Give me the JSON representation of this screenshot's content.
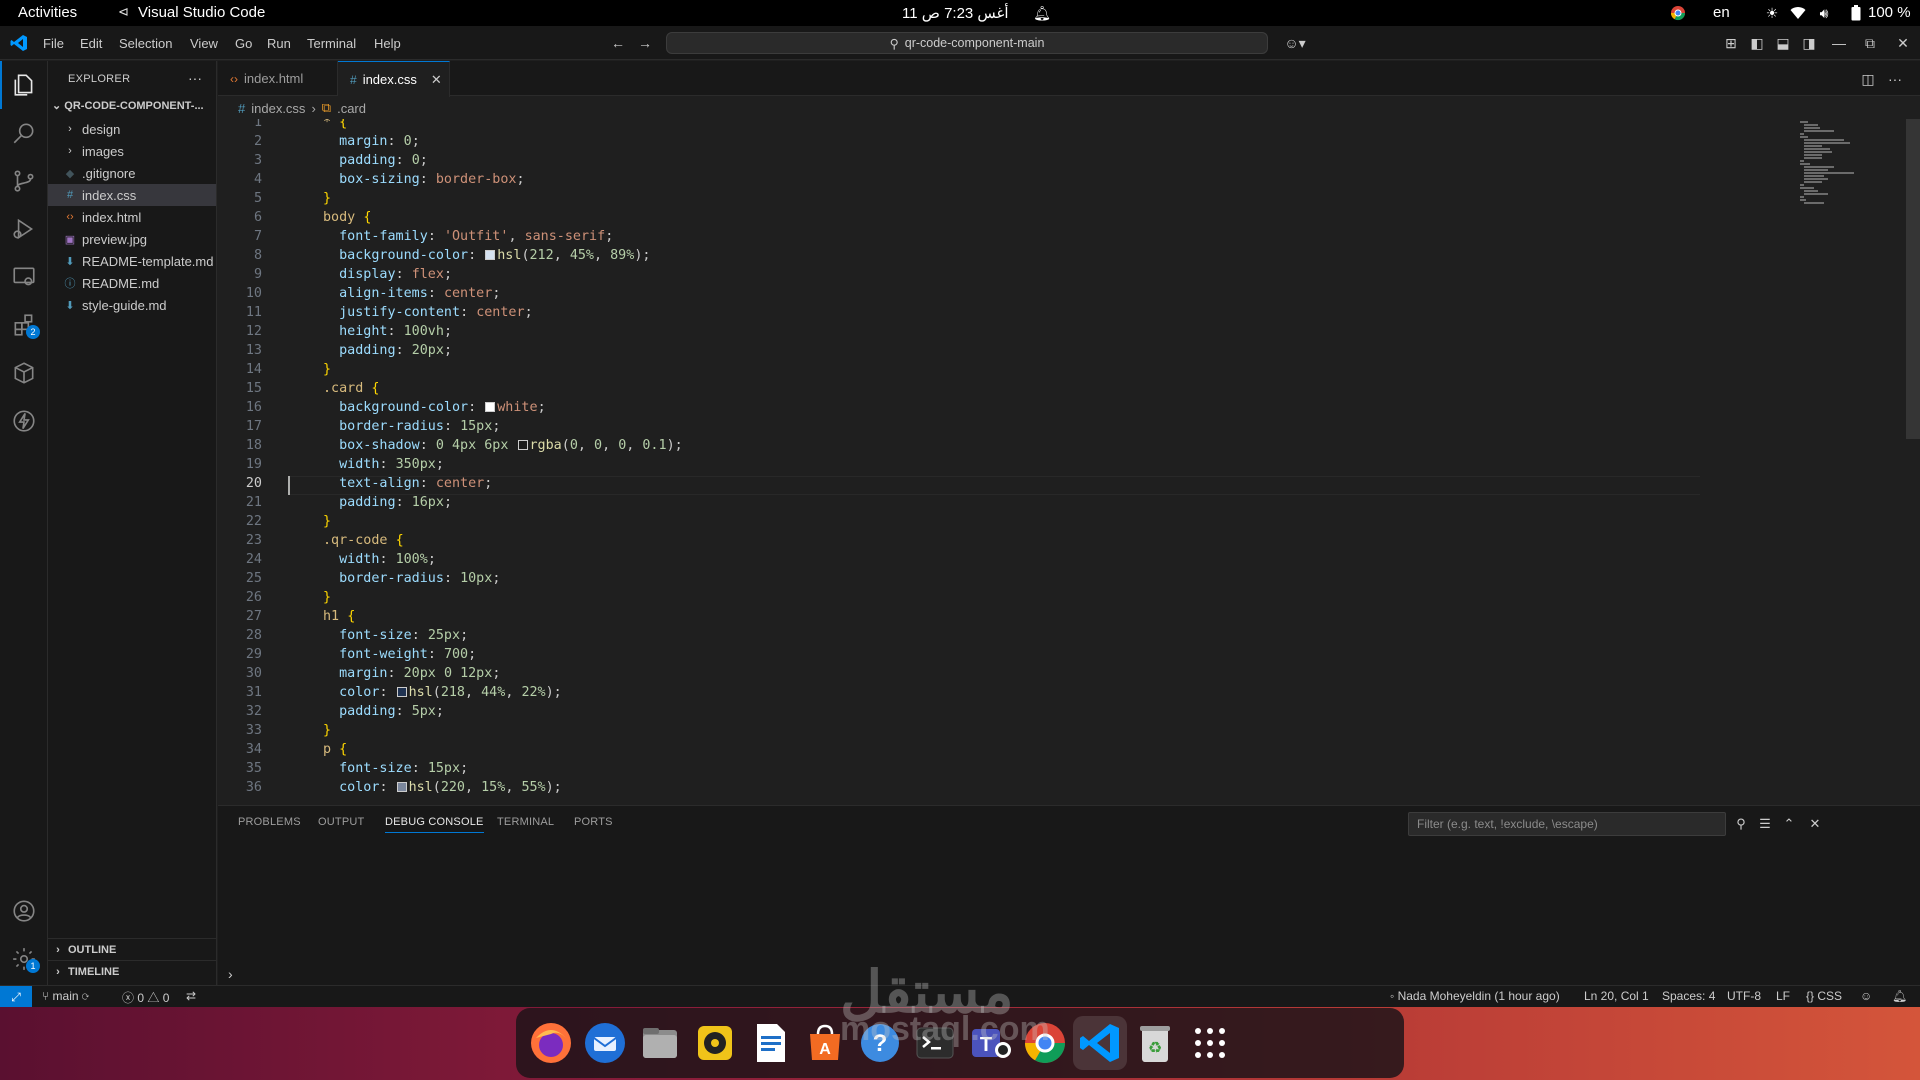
{
  "topbar": {
    "activities": "Activities",
    "app_name": "Visual Studio Code",
    "clock": "11 أغس  7:23 ص",
    "lang": "en",
    "battery": "100 %"
  },
  "menubar": {
    "items": [
      "File",
      "Edit",
      "Selection",
      "View",
      "Go",
      "Run",
      "Terminal",
      "Help"
    ],
    "command_center": "qr-code-component-main"
  },
  "sidebar": {
    "title": "EXPLORER",
    "root": "QR-CODE-COMPONENT-...",
    "items": [
      {
        "label": "design",
        "icon": "chevron-right-icon"
      },
      {
        "label": "images",
        "icon": "chevron-right-icon"
      },
      {
        "label": ".gitignore",
        "icon": "git-icon"
      },
      {
        "label": "index.css",
        "icon": "css-icon"
      },
      {
        "label": "index.html",
        "icon": "html-icon"
      },
      {
        "label": "preview.jpg",
        "icon": "image-icon"
      },
      {
        "label": "README-template.md",
        "icon": "markdown-icon"
      },
      {
        "label": "README.md",
        "icon": "info-icon"
      },
      {
        "label": "style-guide.md",
        "icon": "markdown-icon"
      }
    ],
    "outline": "OUTLINE",
    "timeline": "TIMELINE"
  },
  "tabs": [
    {
      "label": "index.html",
      "active": false
    },
    {
      "label": "index.css",
      "active": true
    }
  ],
  "breadcrumb": {
    "file": "index.css",
    "symbol": ".card"
  },
  "editor": {
    "current_line": 20,
    "lines": [
      "* {",
      "  margin: 0;",
      "  padding: 0;",
      "  box-sizing: border-box;",
      "}",
      "body {",
      "  font-family: 'Outfit', sans-serif;",
      "  background-color: hsl(212, 45%, 89%);",
      "  display: flex;",
      "  align-items: center;",
      "  justify-content: center;",
      "  height: 100vh;",
      "  padding: 20px;",
      "}",
      ".card {",
      "  background-color: white;",
      "  border-radius: 15px;",
      "  box-shadow: 0 4px 6px rgba(0, 0, 0, 0.1);",
      "  width: 350px;",
      "  text-align: center;",
      "  padding: 16px;",
      "}",
      ".qr-code {",
      "  width: 100%;",
      "  border-radius: 10px;",
      "}",
      "h1 {",
      "  font-size: 25px;",
      "  font-weight: 700;",
      "  margin: 20px 0 12px;",
      "  color: hsl(218, 44%, 22%);",
      "  padding: 5px;",
      "}",
      "p {",
      "  font-size: 15px;",
      "  color: hsl(220, 15%, 55%);"
    ]
  },
  "panel": {
    "tabs": [
      "PROBLEMS",
      "OUTPUT",
      "DEBUG CONSOLE",
      "TERMINAL",
      "PORTS"
    ],
    "active_tab": "DEBUG CONSOLE",
    "filter_placeholder": "Filter (e.g. text, !exclude, \\escape)"
  },
  "statusbar": {
    "branch": "main",
    "errors": "0",
    "warnings": "0",
    "blame": "Nada Moheyeldin (1 hour ago)",
    "position": "Ln 20, Col 1",
    "spaces": "Spaces: 4",
    "encoding": "UTF-8",
    "eol": "LF",
    "language": "CSS"
  },
  "watermark": {
    "arabic": "مستقل",
    "latin": "mostaql.com"
  },
  "dock": [
    "firefox-icon",
    "thunderbird-icon",
    "files-icon",
    "rhythmbox-icon",
    "writer-icon",
    "app-center-icon",
    "help-icon",
    "terminal-icon",
    "teams-icon",
    "chrome-icon",
    "vscode-icon",
    "trash-icon",
    "app-grid-icon"
  ],
  "colors": {
    "accent": "#0078d4",
    "editor_bg": "#1f1f1f",
    "sidebar_bg": "#181818"
  }
}
